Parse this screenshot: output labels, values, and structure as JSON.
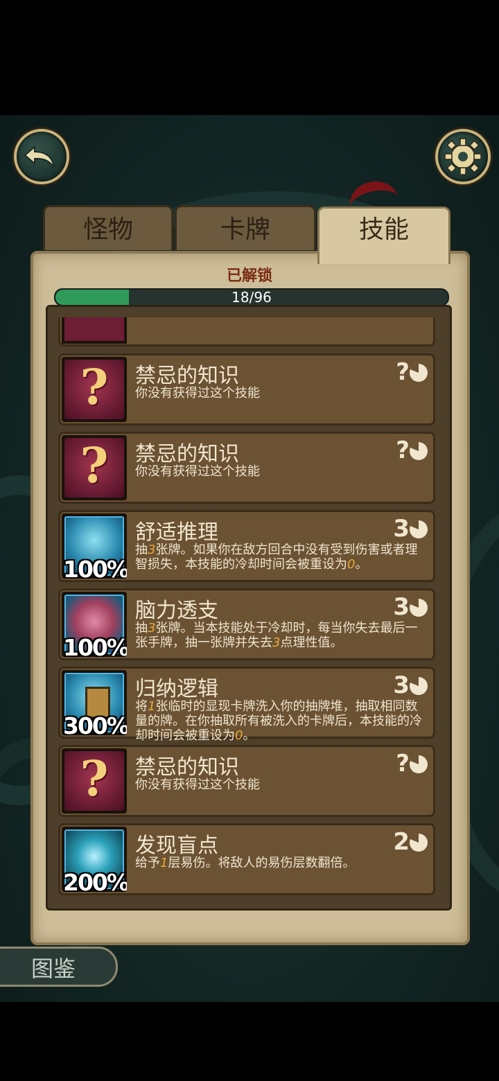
{
  "tabs": [
    {
      "label": "怪物",
      "active": false
    },
    {
      "label": "卡牌",
      "active": false
    },
    {
      "label": "技能",
      "active": true
    }
  ],
  "unlock": {
    "title": "已解锁",
    "text": "18/96",
    "unlocked": 18,
    "total": 96
  },
  "skills": [
    {
      "name": "禁忌的知识",
      "desc": "你没有获得过这个技能",
      "cost": "?",
      "locked": true,
      "percent": ""
    },
    {
      "name": "禁忌的知识",
      "desc": "你没有获得过这个技能",
      "cost": "?",
      "locked": true,
      "percent": ""
    },
    {
      "name": "舒适推理",
      "desc_parts": [
        "抽",
        "3",
        "张牌。如果你在敌方回合中没有受到伤害或者理智损失，本技能的冷却时间会被重设为",
        "0",
        "。"
      ],
      "cost": "3",
      "locked": false,
      "percent": "100%"
    },
    {
      "name": "脑力透支",
      "desc_parts": [
        "抽",
        "3",
        "张牌。当本技能处于冷却时，每当你失去最后一张手牌，抽一张牌并失去",
        "3",
        "点理性值。"
      ],
      "cost": "3",
      "locked": false,
      "percent": "100%"
    },
    {
      "name": "归纳逻辑",
      "desc_parts": [
        "将",
        "1",
        "张临时的显现卡牌洗入你的抽牌堆，抽取相同数量的牌。在你抽取所有被洗入的卡牌后，本技能的冷却时间会被重设为",
        "0",
        "。"
      ],
      "cost": "3",
      "locked": false,
      "percent": "300%"
    },
    {
      "name": "禁忌的知识",
      "desc": "你没有获得过这个技能",
      "cost": "?",
      "locked": true,
      "percent": ""
    },
    {
      "name": "发现盲点",
      "desc_parts": [
        "给予",
        "1",
        "层易伤。将敌人的易伤层数翻倍。",
        "",
        ""
      ],
      "cost": "2",
      "locked": false,
      "percent": "200%"
    }
  ],
  "codex": {
    "label": "图鉴"
  },
  "icons": {
    "back": "back-arrow-icon",
    "settings": "gear-icon",
    "cooldown": "cooldown-clock-icon"
  },
  "colors": {
    "accent": "#c9b37a",
    "progress": "#2f9a5a",
    "highlight": "#e8a93a"
  }
}
